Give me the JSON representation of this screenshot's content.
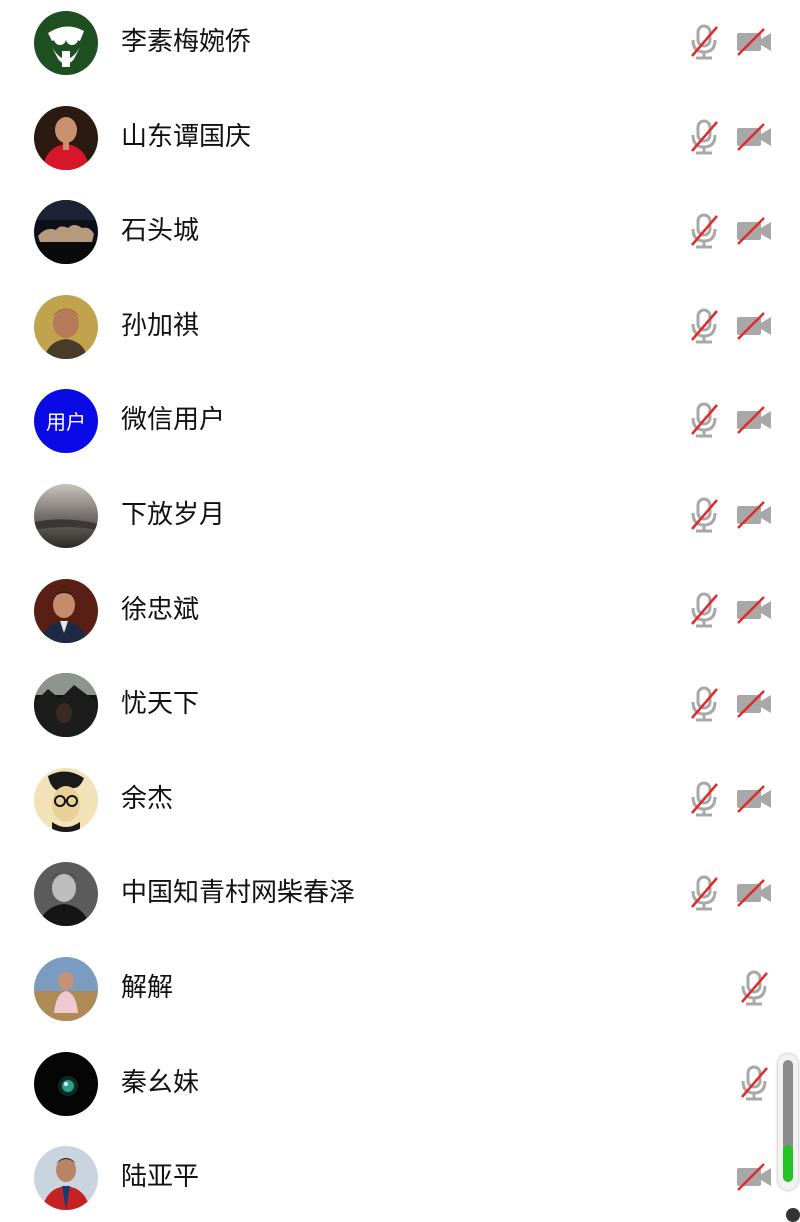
{
  "participants": [
    {
      "name": "李素梅婉侨",
      "avatar": "avatar-green-logo",
      "mic": "muted",
      "video": "off"
    },
    {
      "name": "山东谭国庆",
      "avatar": "avatar-man-red-shirt",
      "mic": "muted",
      "video": "off"
    },
    {
      "name": "石头城",
      "avatar": "avatar-dark-landscape",
      "mic": "muted",
      "video": "off"
    },
    {
      "name": "孙加祺",
      "avatar": "avatar-man-yellow-bg",
      "mic": "muted",
      "video": "off"
    },
    {
      "name": "微信用户",
      "avatar": "avatar-text-blue",
      "avatar_text": "用户",
      "mic": "muted",
      "video": "off"
    },
    {
      "name": "下放岁月",
      "avatar": "avatar-grey-landscape",
      "mic": "muted",
      "video": "off"
    },
    {
      "name": "徐忠斌",
      "avatar": "avatar-man-suit",
      "mic": "muted",
      "video": "off"
    },
    {
      "name": "忧天下",
      "avatar": "avatar-dark-mountain",
      "mic": "muted",
      "video": "off"
    },
    {
      "name": "余杰",
      "avatar": "avatar-sketch-face",
      "mic": "muted",
      "video": "off"
    },
    {
      "name": "中国知青村网柴春泽",
      "avatar": "avatar-bw-portrait",
      "mic": "muted",
      "video": "off"
    },
    {
      "name": "解解",
      "avatar": "avatar-person-outdoors",
      "mic": "muted",
      "video": null
    },
    {
      "name": "秦幺妹",
      "avatar": "avatar-black-orb",
      "mic": "muted",
      "video": null
    },
    {
      "name": "陆亚平",
      "avatar": "avatar-person-red-jacket",
      "mic": null,
      "video": "off"
    }
  ],
  "icons": {
    "mic_muted": "mic-muted-icon",
    "video_off": "video-off-icon"
  },
  "colors": {
    "icon_grey": "#a8a8a8",
    "slash_red": "#e12a2a",
    "avatar_blue": "#0a0ae6",
    "scroll_green": "#22c322"
  },
  "scrollbar": {
    "level": 0.3
  }
}
